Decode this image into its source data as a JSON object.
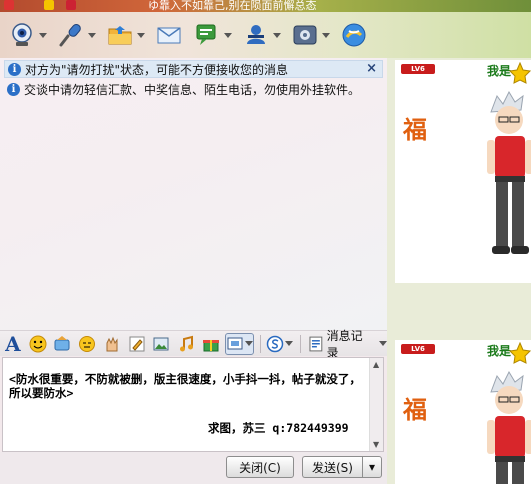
{
  "title_bar": {
    "text": "ゆ靠入不如靠己,别在陨面前懈总态"
  },
  "toolbar": {
    "buttons": [
      {
        "name": "video",
        "icon": "webcam-icon"
      },
      {
        "name": "voice",
        "icon": "microphone-icon"
      },
      {
        "name": "file",
        "icon": "folder-icon"
      },
      {
        "name": "email",
        "icon": "mail-icon"
      },
      {
        "name": "message",
        "icon": "sms-icon"
      },
      {
        "name": "group",
        "icon": "group-icon"
      },
      {
        "name": "app",
        "icon": "app-box-icon"
      },
      {
        "name": "remote",
        "icon": "remote-assist-icon"
      }
    ]
  },
  "notices": {
    "status": "对方为\"请勿打扰\"状态，可能不方便接收您的消息",
    "close": "×",
    "security": "交谈中请勿轻信汇款、中奖信息、陌生电话，勿使用外挂软件。"
  },
  "format_bar": {
    "font_glyph": "A",
    "message_record": "消息记录"
  },
  "input": {
    "text": "<防水很重要，不防就被删，版主很速度，小手抖一抖，帖子就没了，所以要防水>",
    "signature": "求图，苏三 q:782449399"
  },
  "buttons": {
    "close": "关闭(C)",
    "send": "发送(S)",
    "send_arrow": "▾"
  },
  "right_panel": {
    "level_badge": "LV6",
    "me_label": "我是",
    "blessing": "福"
  }
}
